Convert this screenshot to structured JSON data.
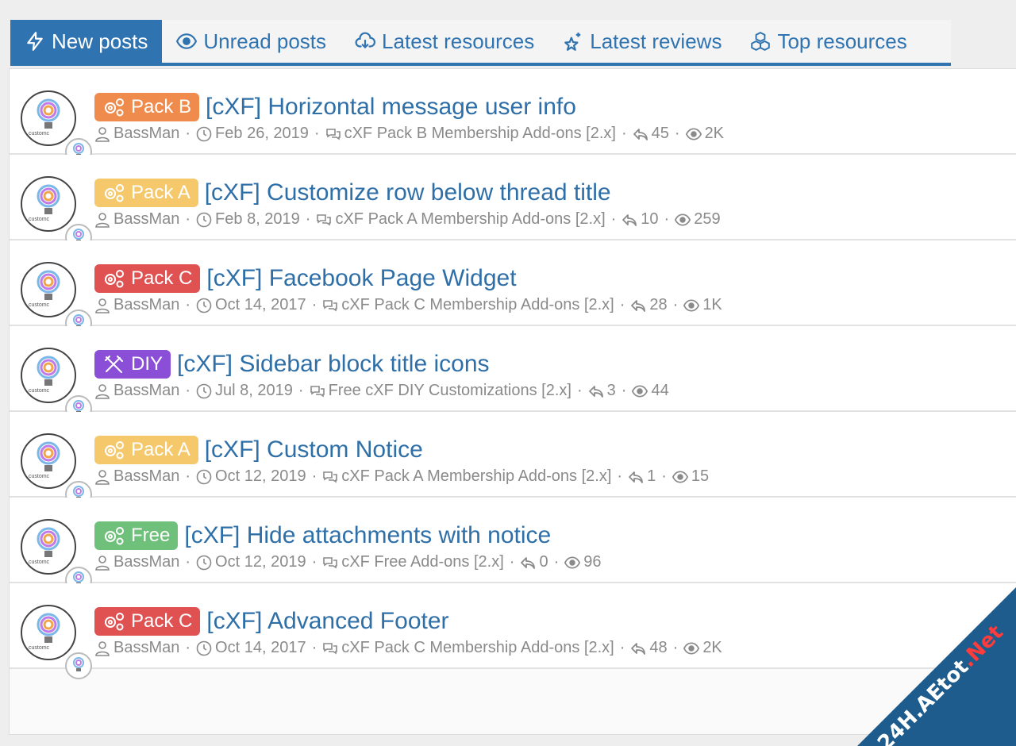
{
  "tabs": [
    {
      "label": "New posts",
      "icon": "bolt-icon",
      "active": true
    },
    {
      "label": "Unread posts",
      "icon": "eye-icon",
      "active": false
    },
    {
      "label": "Latest resources",
      "icon": "cloud-download-icon",
      "active": false
    },
    {
      "label": "Latest reviews",
      "icon": "sparkle-star-icon",
      "active": false
    },
    {
      "label": "Top resources",
      "icon": "cubes-icon",
      "active": false
    }
  ],
  "colors": {
    "accent": "#2f73b1",
    "pack_a": "#f5c96b",
    "pack_b": "#ef8c4d",
    "pack_c": "#e05252",
    "diy": "#8a4fd6",
    "free": "#6ec07a"
  },
  "threads": [
    {
      "badge": "Pack B",
      "badge_icon": "gears-icon",
      "title": "[cXF] Horizontal message user info",
      "author": "BassMan",
      "date": "Feb 26, 2019",
      "forum": "cXF Pack B Membership Add-ons [2.x]",
      "replies": "45",
      "views": "2K"
    },
    {
      "badge": "Pack A",
      "badge_icon": "gears-icon",
      "title": "[cXF] Customize row below thread title",
      "author": "BassMan",
      "date": "Feb 8, 2019",
      "forum": "cXF Pack A Membership Add-ons [2.x]",
      "replies": "10",
      "views": "259"
    },
    {
      "badge": "Pack C",
      "badge_icon": "gears-icon",
      "title": "[cXF] Facebook Page Widget",
      "author": "BassMan",
      "date": "Oct 14, 2017",
      "forum": "cXF Pack C Membership Add-ons [2.x]",
      "replies": "28",
      "views": "1K"
    },
    {
      "badge": "DIY",
      "badge_icon": "tools-icon",
      "title": "[cXF] Sidebar block title icons",
      "author": "BassMan",
      "date": "Jul 8, 2019",
      "forum": "Free cXF DIY Customizations [2.x]",
      "replies": "3",
      "views": "44"
    },
    {
      "badge": "Pack A",
      "badge_icon": "gears-icon",
      "title": "[cXF] Custom Notice",
      "author": "BassMan",
      "date": "Oct 12, 2019",
      "forum": "cXF Pack A Membership Add-ons [2.x]",
      "replies": "1",
      "views": "15"
    },
    {
      "badge": "Free",
      "badge_icon": "gears-icon",
      "title": "[cXF] Hide attachments with notice",
      "author": "BassMan",
      "date": "Oct 12, 2019",
      "forum": "cXF Free Add-ons [2.x]",
      "replies": "0",
      "views": "96"
    },
    {
      "badge": "Pack C",
      "badge_icon": "gears-icon",
      "title": "[cXF] Advanced Footer",
      "author": "BassMan",
      "date": "Oct 14, 2017",
      "forum": "cXF Pack C Membership Add-ons [2.x]",
      "replies": "48",
      "views": "2K"
    }
  ],
  "meta_sep": "·",
  "avatar_word": "customc",
  "watermark": {
    "main": "24H.AEtot",
    "suffix": ".Net"
  }
}
